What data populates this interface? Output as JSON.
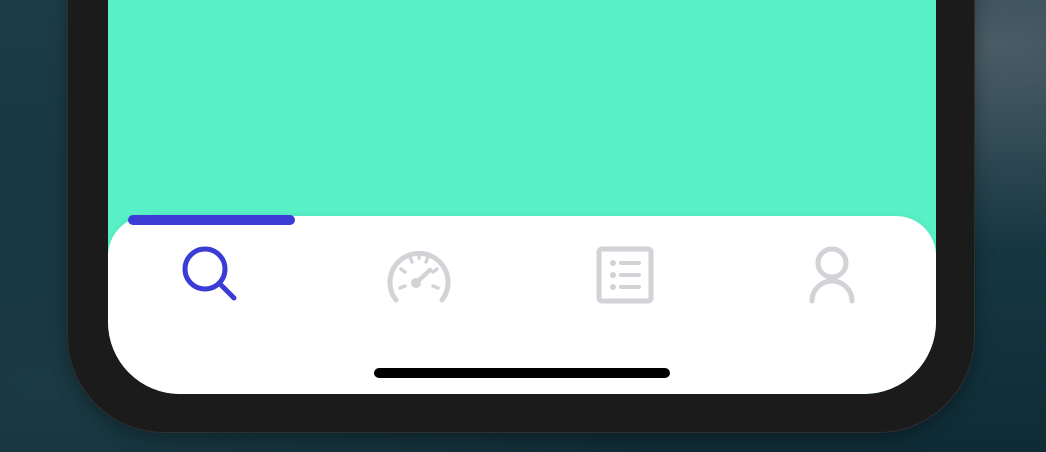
{
  "colors": {
    "screen_background": "#58f0c7",
    "tab_bar_background": "#ffffff",
    "active_tab": "#3b3bd6",
    "inactive_tab": "#d3d3d7",
    "phone_frame": "#1b1b1b",
    "home_indicator": "#000000"
  },
  "tab_bar": {
    "active_index": 0,
    "tabs": [
      {
        "icon": "search-icon",
        "active": true
      },
      {
        "icon": "speedometer-icon",
        "active": false
      },
      {
        "icon": "list-icon",
        "active": false
      },
      {
        "icon": "user-icon",
        "active": false
      }
    ]
  }
}
